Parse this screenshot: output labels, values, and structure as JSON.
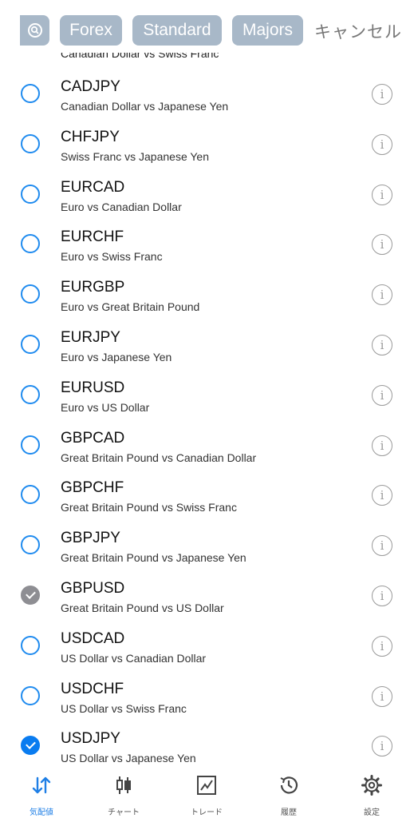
{
  "filters": {
    "search_icon": "search-icon",
    "chips": [
      "Forex",
      "Standard",
      "Majors"
    ],
    "cancel_label": "キャンセル"
  },
  "partial_previous_description": "Canadian Dollar vs Swiss Franc",
  "symbols": [
    {
      "symbol": "CADJPY",
      "description": "Canadian Dollar vs Japanese Yen",
      "state": "unselected"
    },
    {
      "symbol": "CHFJPY",
      "description": "Swiss Franc vs Japanese Yen",
      "state": "unselected"
    },
    {
      "symbol": "EURCAD",
      "description": "Euro vs Canadian Dollar",
      "state": "unselected"
    },
    {
      "symbol": "EURCHF",
      "description": "Euro vs Swiss Franc",
      "state": "unselected"
    },
    {
      "symbol": "EURGBP",
      "description": "Euro vs Great Britain Pound",
      "state": "unselected"
    },
    {
      "symbol": "EURJPY",
      "description": "Euro vs Japanese Yen",
      "state": "unselected"
    },
    {
      "symbol": "EURUSD",
      "description": "Euro vs US Dollar",
      "state": "unselected"
    },
    {
      "symbol": "GBPCAD",
      "description": "Great Britain Pound vs Canadian Dollar",
      "state": "unselected"
    },
    {
      "symbol": "GBPCHF",
      "description": "Great Britain Pound vs Swiss Franc",
      "state": "unselected"
    },
    {
      "symbol": "GBPJPY",
      "description": "Great Britain Pound vs Japanese Yen",
      "state": "unselected"
    },
    {
      "symbol": "GBPUSD",
      "description": "Great Britain Pound vs US Dollar",
      "state": "selected-disabled"
    },
    {
      "symbol": "USDCAD",
      "description": "US Dollar vs Canadian Dollar",
      "state": "unselected"
    },
    {
      "symbol": "USDCHF",
      "description": "US Dollar vs Swiss Franc",
      "state": "unselected"
    },
    {
      "symbol": "USDJPY",
      "description": "US Dollar vs Japanese Yen",
      "state": "selected"
    }
  ],
  "tabs": [
    {
      "label": "気配値",
      "icon": "quotes-arrows-icon",
      "active": true
    },
    {
      "label": "チャート",
      "icon": "candlestick-chart-icon",
      "active": false
    },
    {
      "label": "トレード",
      "icon": "trade-chart-icon",
      "active": false
    },
    {
      "label": "履歴",
      "icon": "history-clock-icon",
      "active": false
    },
    {
      "label": "設定",
      "icon": "gear-icon",
      "active": false
    }
  ],
  "colors": {
    "accent": "#1f7fe6",
    "chip_bg": "#a8b8c8",
    "radio_disabled": "#8e8e93",
    "info_gray": "#9a9a9a"
  }
}
